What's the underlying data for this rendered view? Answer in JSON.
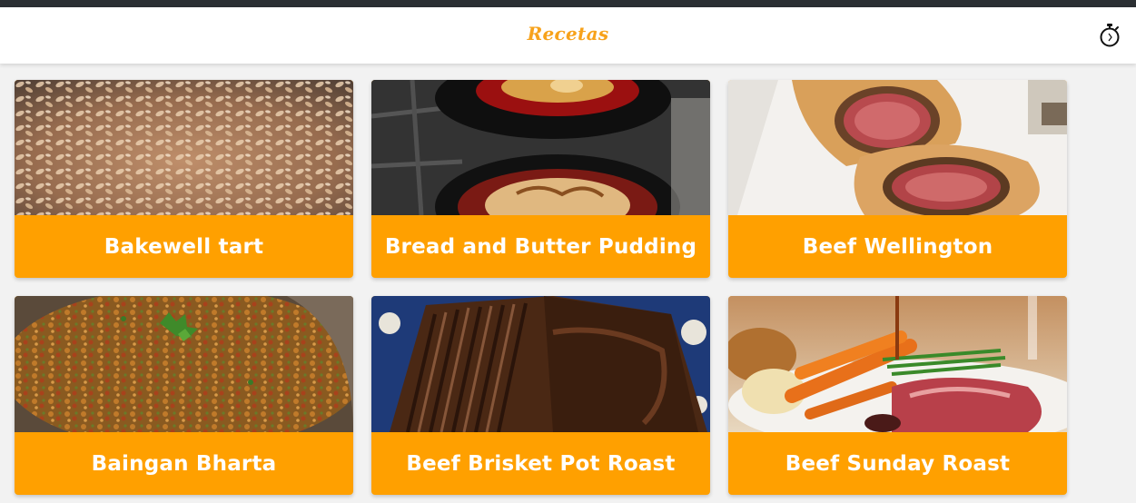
{
  "app": {
    "brand": "Recetas",
    "accent_color": "#ffa000",
    "brand_color": "#f7a21b",
    "timer_icon": "stopwatch-icon"
  },
  "recipes": [
    {
      "title": "Bakewell tart",
      "image": "bakewell-tart-photo"
    },
    {
      "title": "Bread and Butter Pudding",
      "image": "bread-butter-pudding-photo"
    },
    {
      "title": "Beef Wellington",
      "image": "beef-wellington-photo"
    },
    {
      "title": "Baingan Bharta",
      "image": "baingan-bharta-photo"
    },
    {
      "title": "Beef Brisket Pot Roast",
      "image": "beef-brisket-photo"
    },
    {
      "title": "Beef Sunday Roast",
      "image": "beef-sunday-roast-photo"
    }
  ]
}
